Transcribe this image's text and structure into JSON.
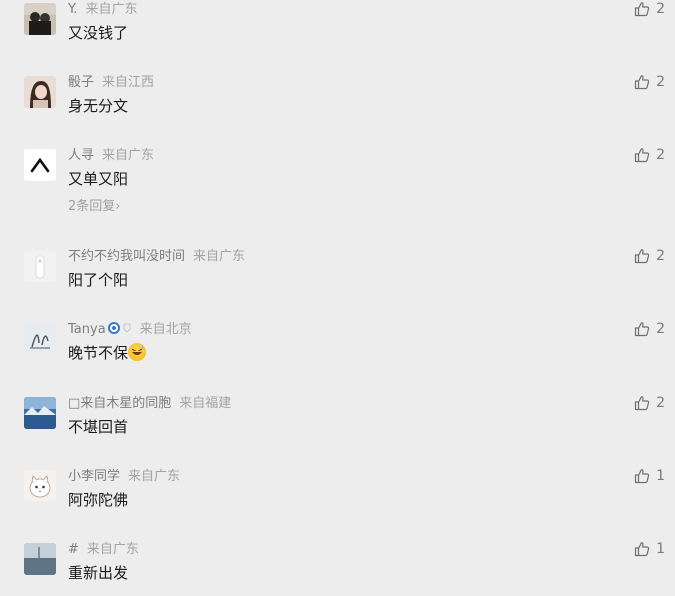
{
  "colors": {
    "background": "#ededed",
    "name": "#7d7d7d",
    "location": "#a3a3a3",
    "text": "#1a1a1a",
    "like": "#7a7a7a"
  },
  "comments": [
    {
      "name": "Y.",
      "location": "来自广东",
      "text": "又没钱了",
      "likes": "2",
      "avatar_icon": "avatar-photo-couple"
    },
    {
      "name": "骰子",
      "location": "来自江西",
      "text": "身无分文",
      "likes": "2",
      "avatar_icon": "avatar-photo-girl"
    },
    {
      "name": "人寻",
      "location": "来自广东",
      "text": "又单又阳",
      "likes": "2",
      "replies": "2条回复›",
      "avatar_icon": "avatar-caret-logo"
    },
    {
      "name": "不约不约我叫没时间",
      "location": "来自广东",
      "text": "阳了个阳",
      "likes": "2",
      "avatar_icon": "avatar-white-object"
    },
    {
      "name": "Tanya",
      "location": "来自北京",
      "text": "晚节不保",
      "text_emoji": "grinning-sweat-emoji",
      "likes": "2",
      "avatar_icon": "avatar-sketch"
    },
    {
      "name": "□来自木星的同胞",
      "location": "来自福建",
      "text": "不堪回首",
      "likes": "2",
      "avatar_icon": "avatar-mountain-sea"
    },
    {
      "name": "小李同学",
      "location": "来自广东",
      "text": "阿弥陀佛",
      "likes": "1",
      "avatar_icon": "avatar-cartoon-cat"
    },
    {
      "name": "#",
      "location": "来自广东",
      "text": "重新出发",
      "likes": "1",
      "avatar_icon": "avatar-seascape"
    }
  ]
}
